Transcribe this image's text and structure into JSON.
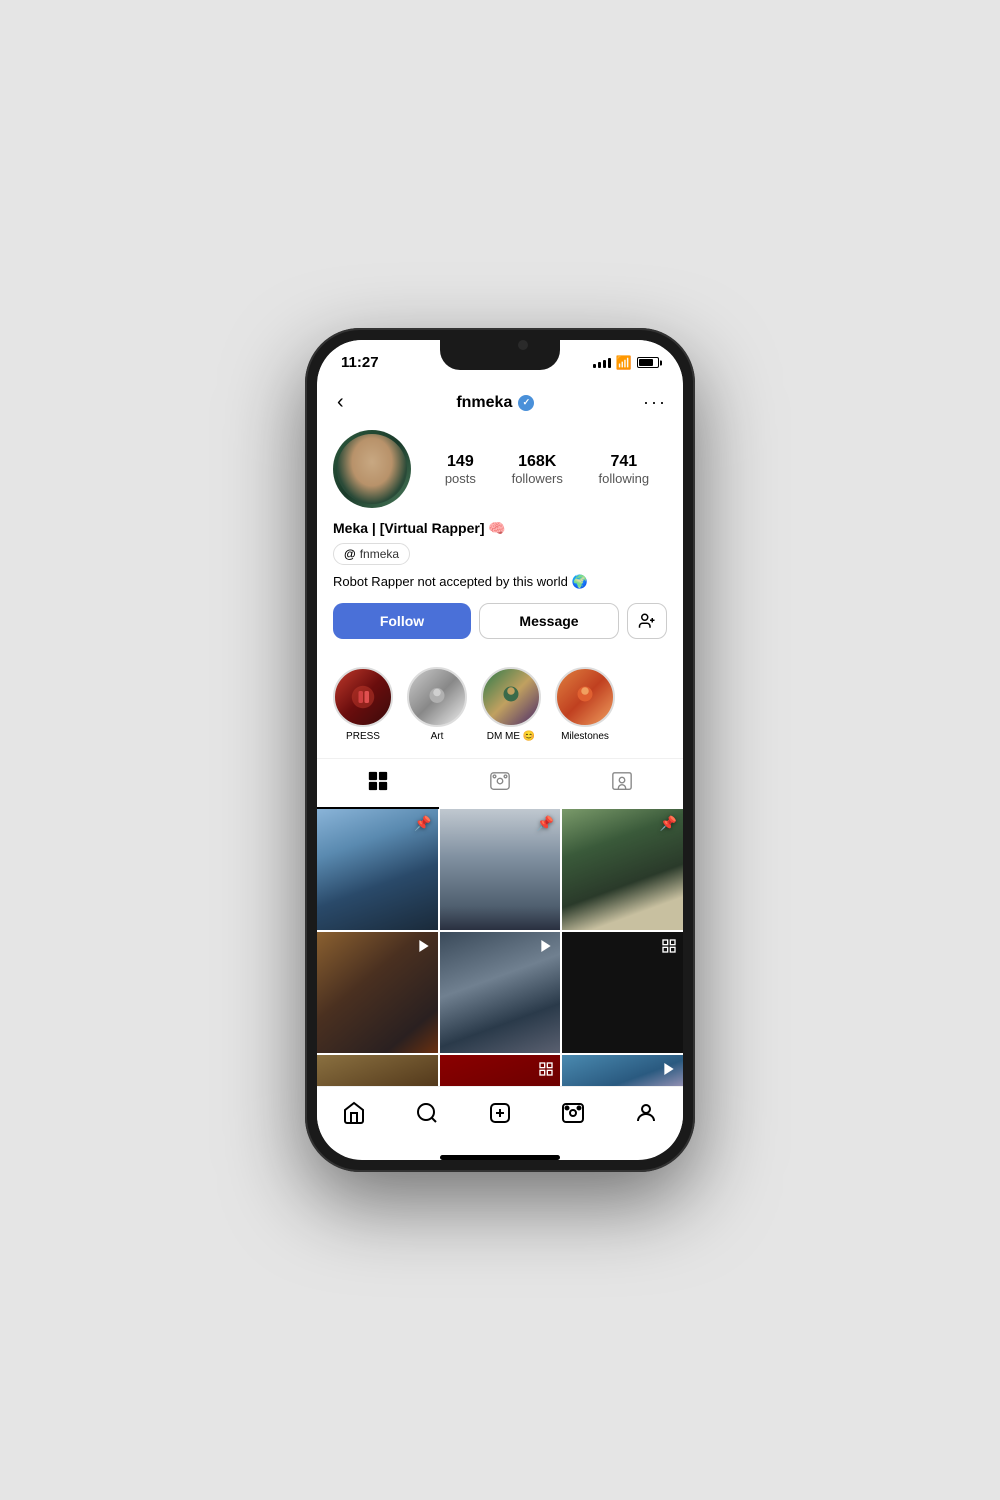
{
  "statusBar": {
    "time": "11:27"
  },
  "header": {
    "username": "fnmeka",
    "backLabel": "‹",
    "moreLabel": "···"
  },
  "profile": {
    "name": "Meka | [Virtual Rapper] 🧠",
    "threadsBadge": "fnmeka",
    "bio": "Robot Rapper not accepted by this world 🌍",
    "stats": {
      "posts": {
        "value": "149",
        "label": "posts"
      },
      "followers": {
        "value": "168K",
        "label": "followers"
      },
      "following": {
        "value": "741",
        "label": "following"
      }
    }
  },
  "buttons": {
    "follow": "Follow",
    "message": "Message",
    "addFriend": "+"
  },
  "highlights": [
    {
      "label": "PRESS"
    },
    {
      "label": "Art"
    },
    {
      "label": "DM ME 😊"
    },
    {
      "label": "Milestones"
    }
  ],
  "tabs": [
    {
      "id": "grid",
      "icon": "⊞",
      "label": "Grid"
    },
    {
      "id": "reels",
      "icon": "▷",
      "label": "Reels"
    },
    {
      "id": "tagged",
      "icon": "👤",
      "label": "Tagged"
    }
  ],
  "bottomNav": [
    {
      "id": "home",
      "icon": "⌂",
      "label": "Home"
    },
    {
      "id": "search",
      "icon": "⌕",
      "label": "Search"
    },
    {
      "id": "add",
      "icon": "⊞",
      "label": "Add"
    },
    {
      "id": "reels",
      "icon": "▷",
      "label": "Reels"
    },
    {
      "id": "profile",
      "icon": "◯",
      "label": "Profile"
    }
  ]
}
